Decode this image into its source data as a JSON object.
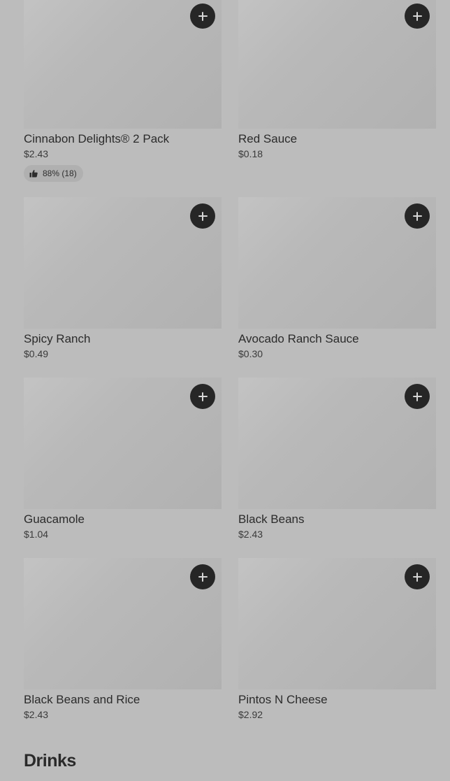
{
  "menu": {
    "items": [
      {
        "name": "Cinnabon Delights® 2 Pack",
        "price": "$2.43",
        "rating": "88% (18)"
      },
      {
        "name": "Red Sauce",
        "price": "$0.18"
      },
      {
        "name": "Spicy Ranch",
        "price": "$0.49"
      },
      {
        "name": "Avocado Ranch Sauce",
        "price": "$0.30"
      },
      {
        "name": "Guacamole",
        "price": "$1.04"
      },
      {
        "name": "Black Beans",
        "price": "$2.43"
      },
      {
        "name": "Black Beans and Rice",
        "price": "$2.43"
      },
      {
        "name": "Pintos N Cheese",
        "price": "$2.92"
      }
    ]
  },
  "next_section": {
    "title": "Drinks"
  },
  "icons": {
    "add": "plus-icon",
    "rating": "thumbs-up-icon"
  },
  "colors": {
    "background": "#bcbcbc",
    "add_button": "#262626",
    "text": "#2a2a2a"
  }
}
